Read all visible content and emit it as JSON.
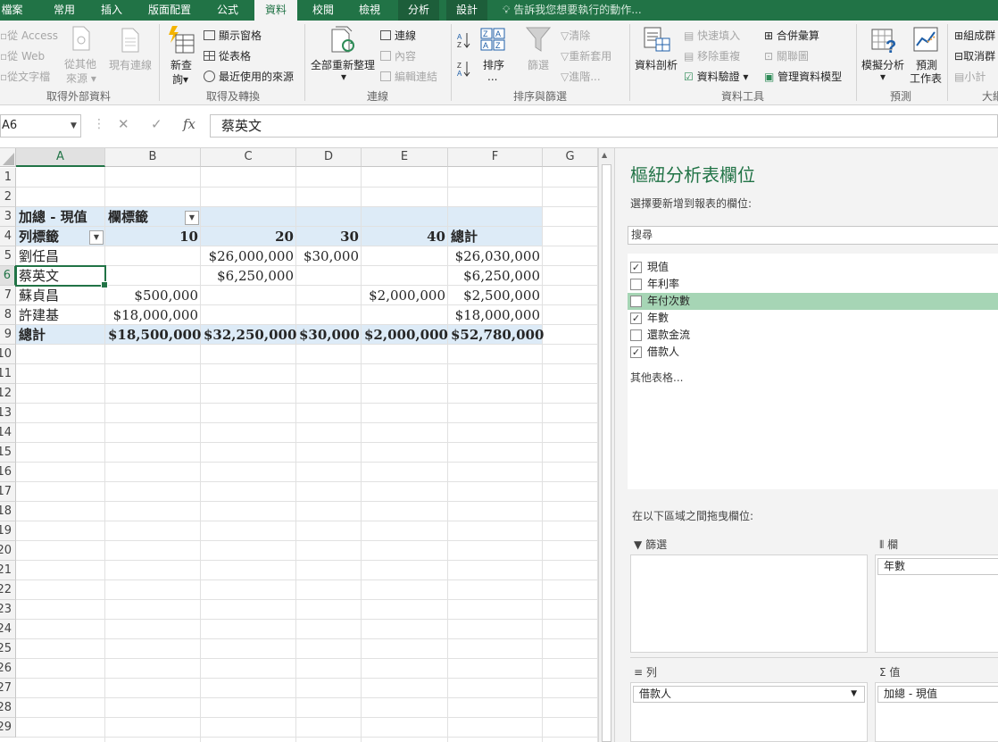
{
  "tabs": [
    {
      "label": "檔案",
      "active": false
    },
    {
      "label": "常用",
      "active": false
    },
    {
      "label": "插入",
      "active": false
    },
    {
      "label": "版面配置",
      "active": false
    },
    {
      "label": "公式",
      "active": false
    },
    {
      "label": "資料",
      "active": true
    },
    {
      "label": "校閱",
      "active": false
    },
    {
      "label": "檢視",
      "active": false
    },
    {
      "label": "分析",
      "active": false
    },
    {
      "label": "設計",
      "active": false
    }
  ],
  "tell_me": "告訴我您想要執行的動作...",
  "ribbon": {
    "get_external": {
      "access": "從 Access",
      "web": "從 Web",
      "text": "從文字檔",
      "other_line1": "從其他",
      "other_line2": "來源",
      "existing": "現有連線",
      "label": "取得外部資料"
    },
    "get_transform": {
      "new_query_line1": "新查",
      "new_query_line2": "詢",
      "show_queries": "顯示窗格",
      "from_table": "從表格",
      "recent_sources": "最近使用的來源",
      "label": "取得及轉換"
    },
    "connections": {
      "refresh_all": "全部重新整理",
      "connections": "連線",
      "properties": "內容",
      "edit_links": "編輯連結",
      "label": "連線"
    },
    "sort_filter": {
      "sort": "排序",
      "filter": "篩選",
      "clear": "清除",
      "reapply": "重新套用",
      "advanced": "進階...",
      "label": "排序與篩選"
    },
    "data_tools": {
      "text_to_columns": "資料剖析",
      "flash_fill": "快速填入",
      "remove_duplicates": "移除重複",
      "data_validation": "資料驗證",
      "consolidate": "合併彙算",
      "relationships": "關聯圖",
      "manage_model": "管理資料模型",
      "label": "資料工具"
    },
    "forecast": {
      "what_if": "模擬分析",
      "forecast_line1": "預測",
      "forecast_line2": "工作表",
      "label": "預測"
    },
    "outline": {
      "group": "組成群",
      "ungroup": "取消群",
      "subtotal": "小計",
      "label": "大綱"
    }
  },
  "formula_bar": {
    "name_box": "A6",
    "cancel": "✕",
    "enter": "✓",
    "fx": "fx",
    "content": "蔡英文"
  },
  "grid": {
    "columns": [
      "A",
      "B",
      "C",
      "D",
      "E",
      "F",
      "G"
    ],
    "rows": [
      "1",
      "2",
      "3",
      "4",
      "5",
      "6",
      "7",
      "8",
      "9",
      "10",
      "11",
      "12",
      "13",
      "14",
      "15",
      "16",
      "17",
      "18",
      "19",
      "20",
      "21",
      "22",
      "23",
      "24",
      "25",
      "26",
      "27",
      "28",
      "29"
    ],
    "selected_column": "A",
    "selected_row": "6"
  },
  "pivot": {
    "value_header": "加總 - 現值",
    "column_labels": "欄標籤",
    "row_labels": "列標籤",
    "col_values": [
      "10",
      "20",
      "30",
      "40"
    ],
    "total_label": "總計",
    "rows": [
      {
        "name": "劉任昌",
        "cells": [
          "",
          "$26,000,000",
          "$30,000",
          ""
        ],
        "total": "$26,030,000"
      },
      {
        "name": "蔡英文",
        "cells": [
          "",
          "$6,250,000",
          "",
          ""
        ],
        "total": "$6,250,000"
      },
      {
        "name": "蘇貞昌",
        "cells": [
          "$500,000",
          "",
          "",
          "$2,000,000"
        ],
        "total": "$2,500,000"
      },
      {
        "name": "許建基",
        "cells": [
          "$18,000,000",
          "",
          "",
          ""
        ],
        "total": "$18,000,000"
      }
    ],
    "grand": {
      "name": "總計",
      "cells": [
        "$18,500,000",
        "$32,250,000",
        "$30,000",
        "$2,000,000"
      ],
      "total": "$52,780,000"
    }
  },
  "pane": {
    "title": "樞紐分析表欄位",
    "subtitle": "選擇要新增到報表的欄位:",
    "search_placeholder": "搜尋",
    "fields": [
      {
        "label": "現值",
        "checked": true
      },
      {
        "label": "年利率",
        "checked": false
      },
      {
        "label": "年付次數",
        "checked": false,
        "highlighted": true
      },
      {
        "label": "年數",
        "checked": true
      },
      {
        "label": "還款金流",
        "checked": false
      },
      {
        "label": "借款人",
        "checked": true
      }
    ],
    "more_tables": "其他表格...",
    "drag_label": "在以下區域之間拖曳欄位:",
    "areas": {
      "filters": {
        "label": "篩選",
        "items": []
      },
      "columns": {
        "label": "欄",
        "items": [
          "年數"
        ]
      },
      "rows": {
        "label": "列",
        "items": [
          "借款人"
        ]
      },
      "values": {
        "label": "值",
        "items": [
          "加總 - 現值"
        ]
      }
    }
  }
}
